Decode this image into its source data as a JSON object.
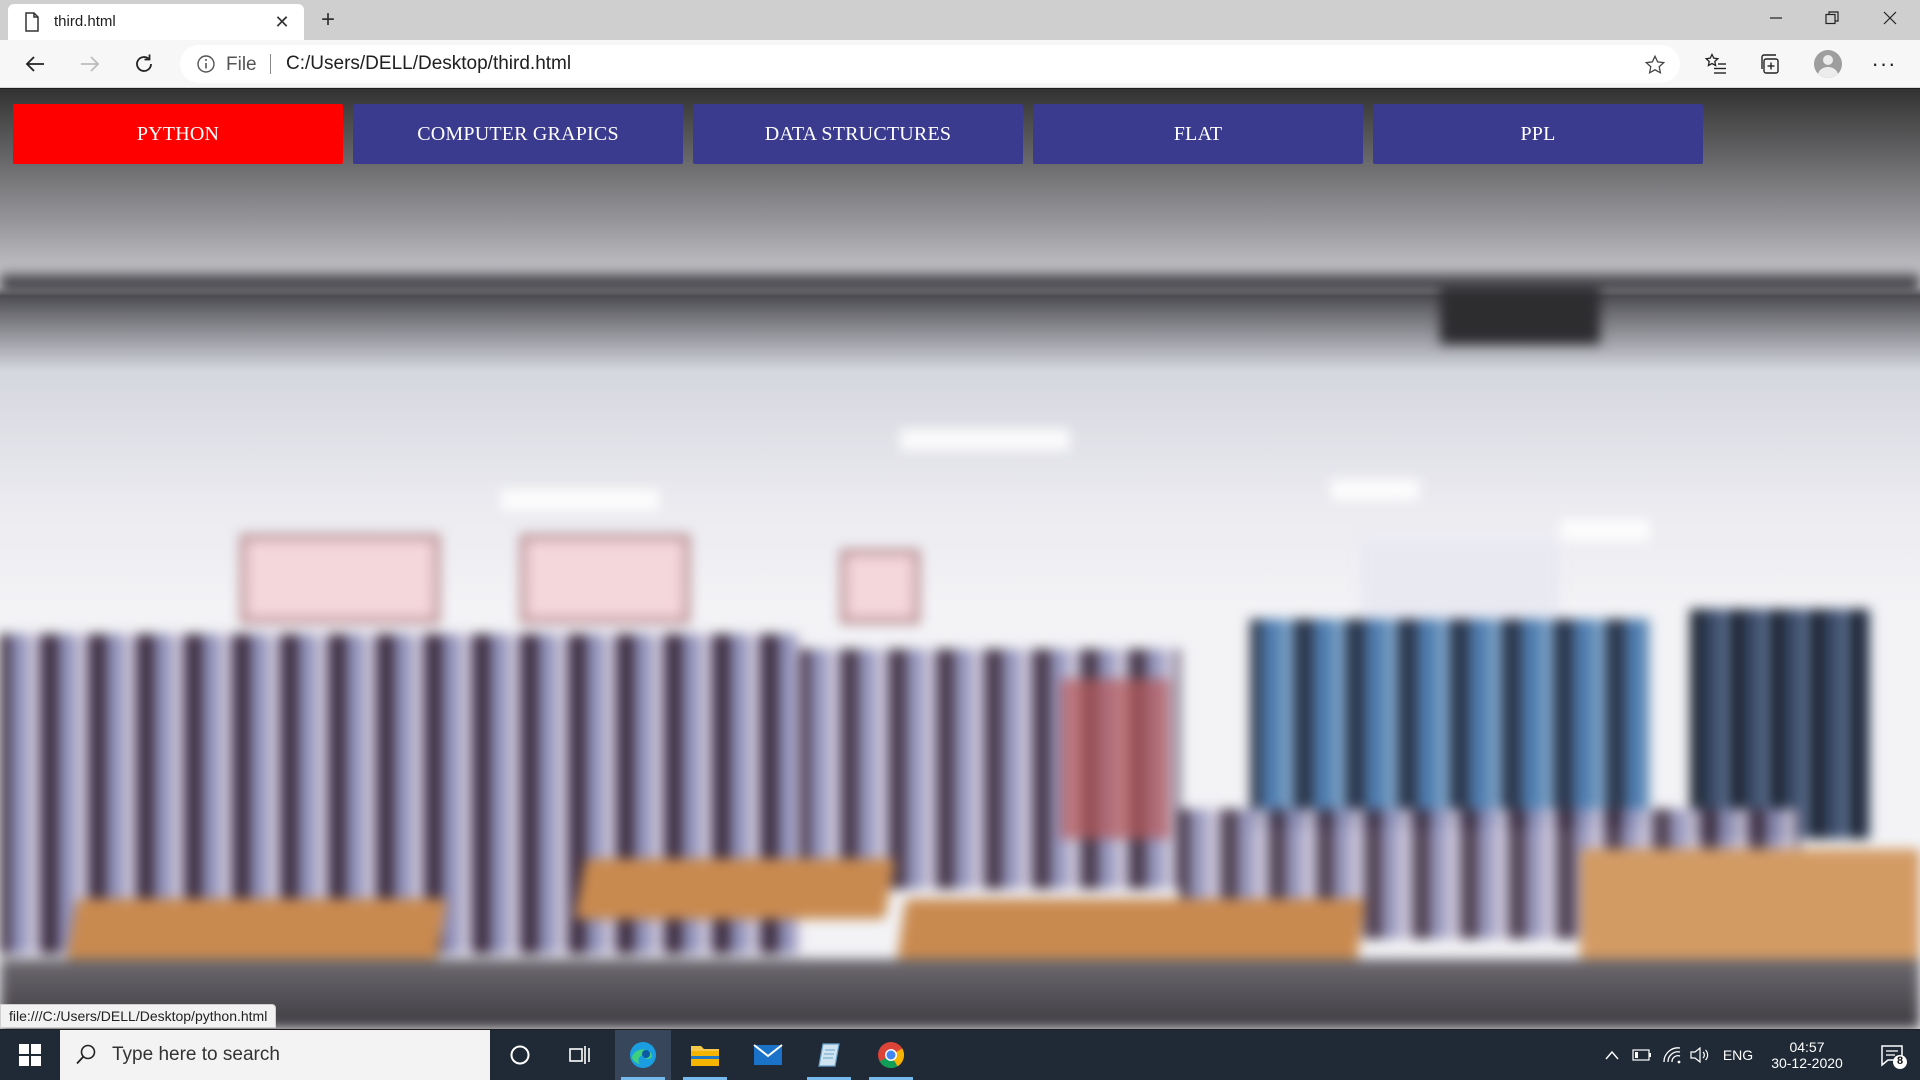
{
  "browser": {
    "tab": {
      "title": "third.html",
      "icon": "page-icon"
    },
    "address": {
      "scheme": "File",
      "url": "C:/Users/DELL/Desktop/third.html"
    }
  },
  "menu": {
    "items": [
      {
        "label": "PYTHON",
        "active": true
      },
      {
        "label": "COMPUTER GRAPICS",
        "active": false
      },
      {
        "label": "DATA STRUCTURES",
        "active": false
      },
      {
        "label": "FLAT",
        "active": false
      },
      {
        "label": "PPL",
        "active": false
      }
    ],
    "active_color": "#ff0000",
    "inactive_color": "#3a3a8f"
  },
  "status_bar": {
    "link": "file:///C:/Users/DELL/Desktop/python.html"
  },
  "taskbar": {
    "search_placeholder": "Type here to search",
    "language": "ENG",
    "time": "04:57",
    "date": "30-12-2020",
    "notifications": "8"
  }
}
